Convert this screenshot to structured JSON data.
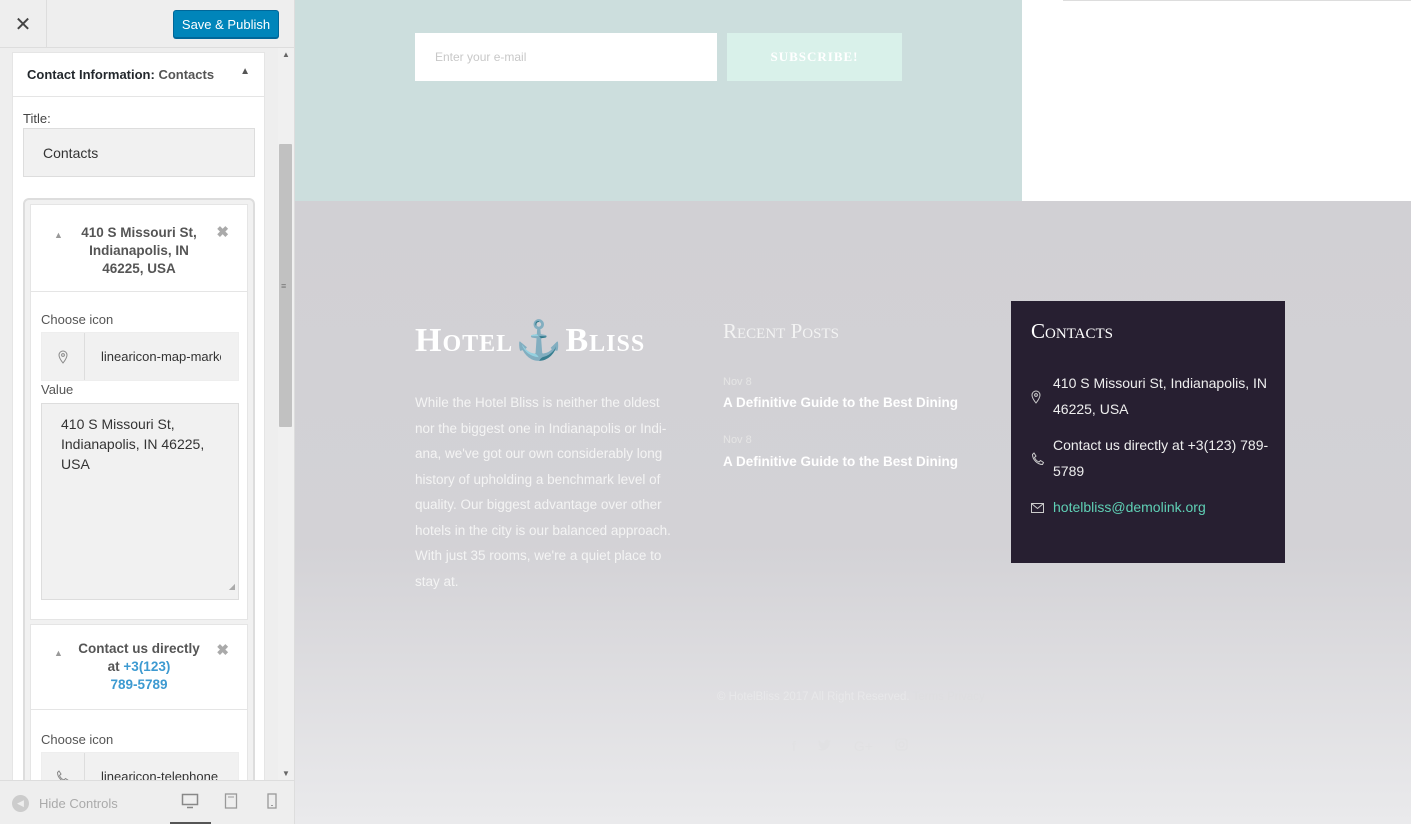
{
  "customizer": {
    "close_label": "✕",
    "publish_label": "Save & Publish",
    "widget": {
      "header_bold": "Contact Information:",
      "header_sub": "Contacts",
      "title_label": "Title:",
      "title_value": "Contacts",
      "items": [
        {
          "header_lines": [
            "410 S Missouri St,",
            "Indianapolis, IN",
            "46225, USA"
          ],
          "choose_icon_label": "Choose icon",
          "icon_value": "linearicon-map-marker",
          "value_label": "Value",
          "value_text": "410 S Missouri St, Indianapolis, IN 46225, USA"
        },
        {
          "header_line1": "Contact us directly",
          "header_line2_prefix": "at",
          "header_line2_link": "+3(123)",
          "header_line3": "789-5789",
          "choose_icon_label": "Choose icon",
          "icon_value": "linearicon-telephone"
        }
      ]
    },
    "footer": {
      "hide_controls_label": "Hide Controls"
    }
  },
  "preview": {
    "newsletter": {
      "email_placeholder": "Enter your e-mail",
      "subscribe_label": "SUBSCRIBE!"
    },
    "footer": {
      "logo_left": "Hotel",
      "logo_right": "Bliss",
      "about_text": "While the Hotel Bliss is neither the oldest nor the biggest one in Indianapolis or Indi-ana, we've got our own considerably long history of upholding a benchmark level of quality. Our biggest advantage over other hotels in the city is our balanced approach. With just 35 rooms, we're a quiet place to stay at.",
      "recent_posts_title": "Recent Posts",
      "posts": [
        {
          "date": "Nov 8",
          "title": "A Definitive Guide to the Best Dining"
        },
        {
          "date": "Nov 8",
          "title": "A Definitive Guide to the Best Dining"
        }
      ],
      "contacts_title": "Contacts",
      "contacts": {
        "address": "410 S Missouri St, Indianapolis, IN 46225, USA",
        "phone": "Contact us directly at +3(123) 789-5789",
        "email": "hotelbliss@demolink.org"
      },
      "copyright": "© HotelBliss 2017 All Right Reserved.",
      "terms_label": "Terms",
      "privacy_label": "Privacy"
    }
  },
  "colors": {
    "publish_blue": "#0085ba",
    "contacts_bg": "#271f31",
    "accent_mint": "#5fd0b5",
    "footer_bg": "#d1d0d4"
  }
}
